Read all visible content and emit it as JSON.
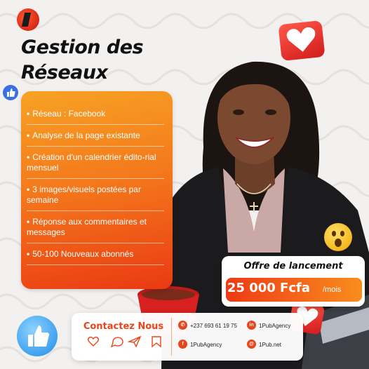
{
  "brand": {
    "logo_icon": "1pub-logo-icon"
  },
  "title": {
    "line1": "Gestion des",
    "line2": "Réseaux"
  },
  "features": [
    "Réseau : Facebook",
    "Analyse de la page existante",
    "Création d'un calendrier édito-rial mensuel",
    "3 images/visuels postées par semaine",
    "Réponse aux commentaires et messages",
    "50-100 Nouveaux abonnés"
  ],
  "offer": {
    "label": "Offre de lancement",
    "price": "25 000 Fcfa",
    "period": "/mois"
  },
  "contact": {
    "title": "Contactez Nous",
    "phone": "+237 693 61 19 75",
    "linkedin": "1PubAgency",
    "facebook": "1PubAgency",
    "website": "1Pub.net"
  },
  "colors": {
    "accent": "#f47a1c",
    "accent_dark": "#e8451a",
    "heart_red": "#d11b1b"
  },
  "icons": [
    "thumbs-up-icon",
    "heart-icon",
    "surprised-emoji-icon",
    "whatsapp-icon",
    "linkedin-icon",
    "facebook-icon",
    "web-icon",
    "like-icon",
    "comment-icon",
    "share-icon",
    "bookmark-icon"
  ]
}
